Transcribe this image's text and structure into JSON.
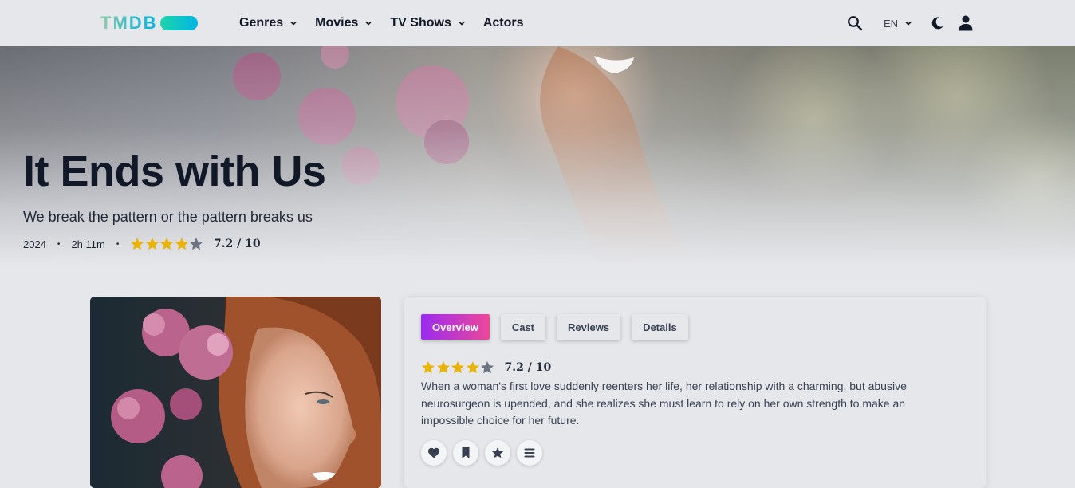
{
  "brand": {
    "logo_text": "TMDB"
  },
  "nav": {
    "items": [
      {
        "label": "Genres",
        "has_dropdown": true
      },
      {
        "label": "Movies",
        "has_dropdown": true
      },
      {
        "label": "TV Shows",
        "has_dropdown": true
      },
      {
        "label": "Actors",
        "has_dropdown": false
      }
    ],
    "language": "EN"
  },
  "movie": {
    "title": "It Ends with Us",
    "tagline": "We break the pattern or the pattern breaks us",
    "year": "2024",
    "runtime": "2h 11m",
    "rating_text": "7.2 / 10",
    "rating_stars": 3.6,
    "overview": "When a woman's first love suddenly reenters her life, her relationship with a charming, but abusive neurosurgeon is upended, and she realizes she must learn to rely on her own strength to make an impossible choice for her future."
  },
  "tabs": [
    {
      "label": "Overview",
      "active": true
    },
    {
      "label": "Cast",
      "active": false
    },
    {
      "label": "Reviews",
      "active": false
    },
    {
      "label": "Details",
      "active": false
    }
  ],
  "actions": [
    "heart-icon",
    "bookmark-icon",
    "star-icon",
    "list-icon"
  ],
  "colors": {
    "star_filled": "#eab308",
    "star_empty": "#6b7280",
    "tab_active_start": "#9b2bf0",
    "tab_active_end": "#ec4899",
    "background": "#e5e7eb"
  }
}
